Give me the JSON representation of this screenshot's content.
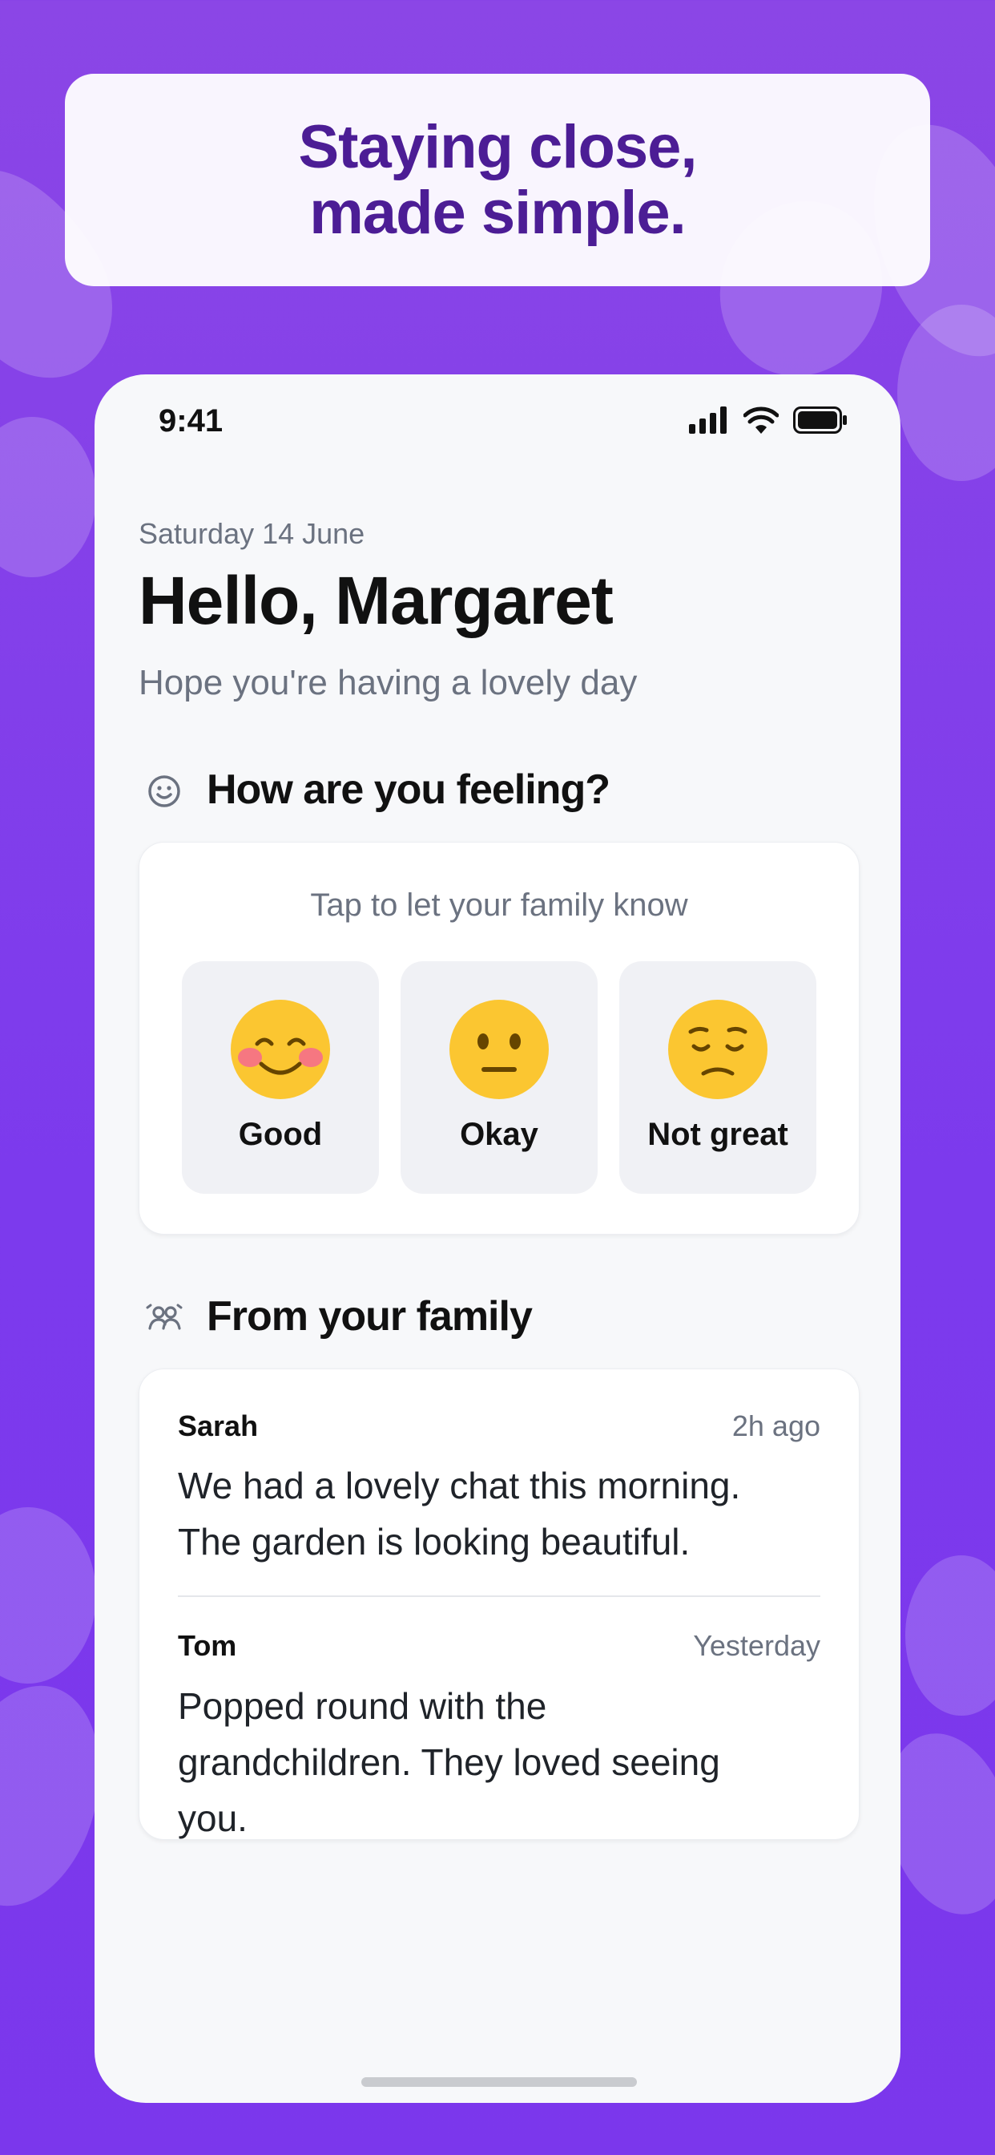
{
  "promo": {
    "line1": "Staying close,",
    "line2": "made simple."
  },
  "status_bar": {
    "time": "9:41",
    "icons": [
      "signal-icon",
      "wifi-icon",
      "battery-icon"
    ]
  },
  "header": {
    "date": "Saturday 14 June",
    "greeting": "Hello, Margaret",
    "subtitle": "Hope you're having a lovely day"
  },
  "mood_section": {
    "title": "How are you feeling?",
    "icon": "smile-icon",
    "prompt": "Tap to let your family know",
    "options": [
      {
        "label": "Good",
        "icon": "smiling-blush-face-icon"
      },
      {
        "label": "Okay",
        "icon": "neutral-face-icon"
      },
      {
        "label": "Not great",
        "icon": "pensive-face-icon"
      }
    ]
  },
  "family_section": {
    "title": "From your family",
    "icon": "family-icon",
    "messages": [
      {
        "sender": "Sarah",
        "time": "2h ago",
        "lines": [
          "We had a lovely chat this morning.",
          "The garden is looking beautiful."
        ]
      },
      {
        "sender": "Tom",
        "time": "Yesterday",
        "lines": [
          "Popped round with the",
          "grandchildren. They loved seeing",
          "you."
        ]
      }
    ]
  },
  "colors": {
    "background": "#7c3aed",
    "promo_text": "#4c1d95",
    "face": "#fbc631",
    "blush": "#f4688f"
  }
}
